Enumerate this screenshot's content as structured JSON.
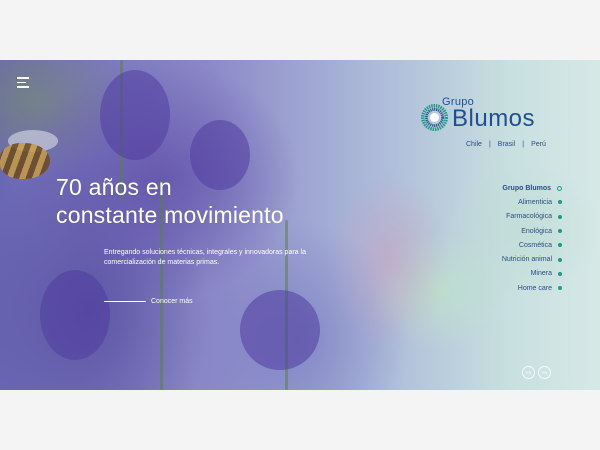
{
  "header": {
    "menu_icon": "hamburger-menu-icon"
  },
  "hero": {
    "headline_line1": "70 años en",
    "headline_line2": "constante movimiento",
    "subtext": "Entregando soluciones técnicas, integrales y innovadoras para la comercialización de materias primas.",
    "cta_label": "Conocer más"
  },
  "logo": {
    "line1": "Grupo",
    "line2": "Blumos",
    "brand_color": "#1f4f8f",
    "accent_color": "#1d9a8a"
  },
  "countries": [
    "Chile",
    "Brasil",
    "Perú"
  ],
  "nav": {
    "items": [
      {
        "label": "Grupo Blumos",
        "active": true
      },
      {
        "label": "Alimenticia",
        "active": false
      },
      {
        "label": "Farmacológica",
        "active": false
      },
      {
        "label": "Enológica",
        "active": false
      },
      {
        "label": "Cosmética",
        "active": false
      },
      {
        "label": "Nutrición animal",
        "active": false
      },
      {
        "label": "Minera",
        "active": false
      },
      {
        "label": "Home care",
        "active": false
      }
    ]
  },
  "languages": [
    "ES",
    "EN"
  ]
}
